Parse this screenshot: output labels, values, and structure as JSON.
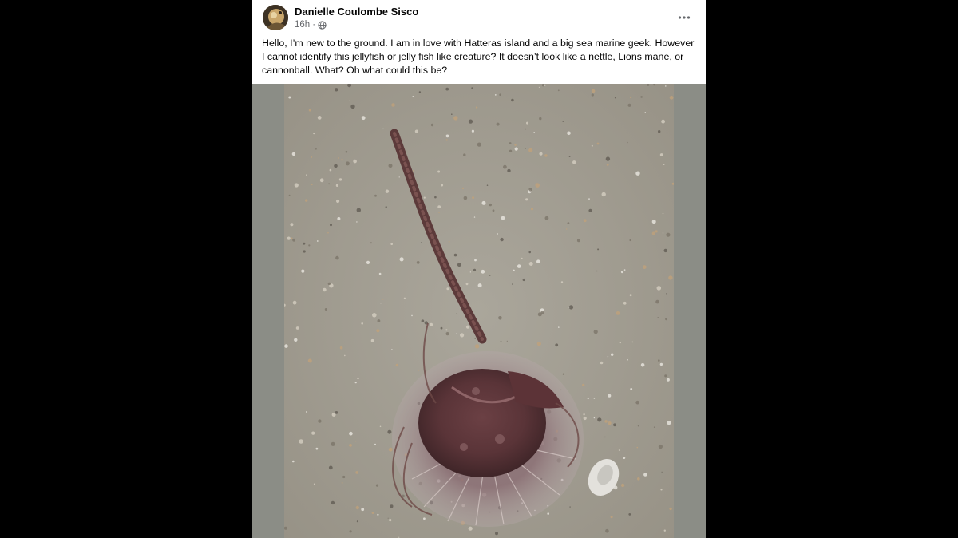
{
  "post": {
    "author": "Danielle Coulombe Sisco",
    "time": "16h",
    "separator": "·",
    "audience_icon": "globe-icon",
    "more_icon": "more-options-icon",
    "text": "Hello, I’m new to the ground. I am in love with Hatteras island and a big sea marine geek. However I cannot identify this jellyfish or jelly fish like creature? It doesn’t look like a nettle, Lions mane, or cannonball. What? Oh what could this be?",
    "photo_subject": "jellyfish-on-sand-photo"
  },
  "colors": {
    "page_background": "#000000",
    "card_background": "#ffffff",
    "author_text": "#050505",
    "meta_text": "#65676b",
    "media_letterbox": "#8b8d86",
    "sand": "#a39f94",
    "jellyfish": "#5a3b3f"
  }
}
